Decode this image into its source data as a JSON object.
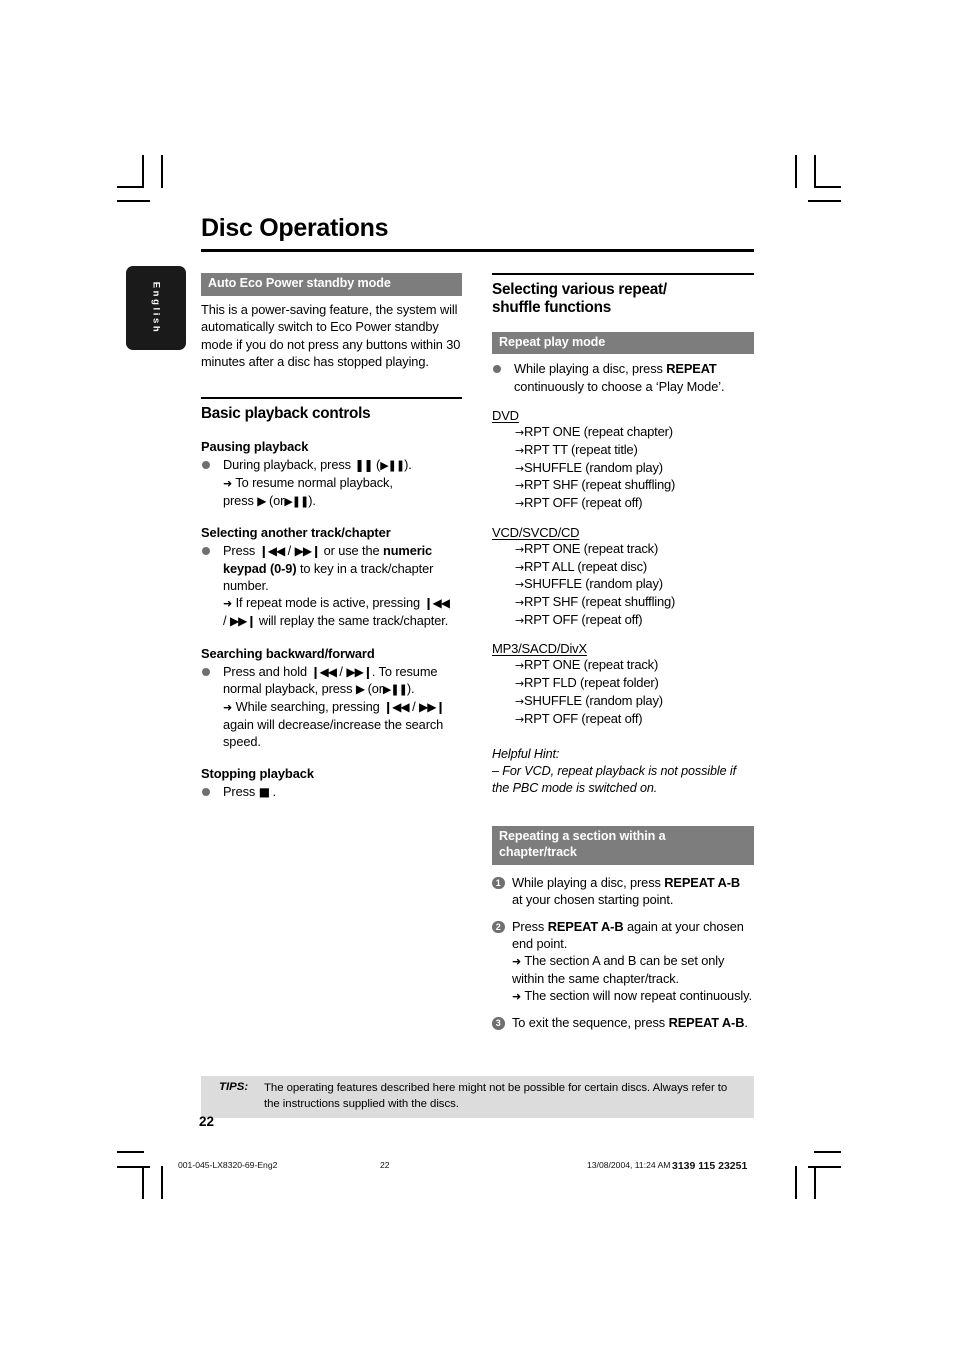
{
  "page": {
    "title": "Disc Operations",
    "language_tab": "English",
    "page_number": "22"
  },
  "left_column": {
    "eco_section": {
      "bar_label": "Auto Eco Power standby mode",
      "body": "This is a power-saving feature, the system will automatically switch to Eco Power standby mode if you do not press any buttons within 30 minutes after a disc has stopped playing."
    },
    "basic_controls": {
      "heading": "Basic playback controls",
      "pausing": {
        "heading": "Pausing playback",
        "line1_pre": "During playback, press",
        "line1_glyph1": "❚❚",
        "line1_mid": "(",
        "line1_glyph2": "▶❚❚",
        "line1_post": ").",
        "arrow_line": "To resume normal playback,",
        "line2_pre": "press",
        "line2_glyph1": "▶",
        "line2_mid": "(or",
        "line2_glyph2": "▶❚❚",
        "line2_post": ")."
      },
      "selecting": {
        "heading": "Selecting another track/chapter",
        "press": "Press",
        "glyph_prev": "❙◀◀",
        "slash": "/",
        "glyph_next": "▶▶❙",
        "or_use": "or use the",
        "numeric_bold": "numeric keypad (0-9)",
        "tail": "to key in a track/chapter number.",
        "arrow_pre": "If repeat mode is active, pressing",
        "arrow_post": "will replay the same track/chapter."
      },
      "searching": {
        "heading": "Searching backward/forward",
        "press_hold": "Press and hold",
        "glyph_prev": "❙◀◀",
        "slash": "/",
        "glyph_next": "▶▶❙",
        "resume": ". To resume normal playback, press",
        "glyph_play": "▶",
        "or_open": "(or",
        "glyph_playpause": "▶❚❚",
        "close": ").",
        "arrow_pre": "While searching, pressing",
        "arrow_post": "again will decrease/increase the search speed."
      },
      "stopping": {
        "heading": "Stopping playback",
        "press": "Press",
        "glyph_stop": "■",
        "period": "."
      }
    }
  },
  "right_column": {
    "repeat_shuffle": {
      "heading_line1": "Selecting various repeat/",
      "heading_line2": "shuffle functions"
    },
    "repeat_play_mode": {
      "bar_label": "Repeat play mode",
      "intro_pre": "While playing a disc, press",
      "intro_bold": "REPEAT",
      "intro_post": "continuously to choose a ‘Play Mode’.",
      "groups": [
        {
          "format": "DVD",
          "modes": [
            "RPT ONE (repeat chapter)",
            "RPT TT (repeat title)",
            "SHUFFLE (random play)",
            "RPT SHF (repeat shuffling)",
            "RPT OFF (repeat off)"
          ]
        },
        {
          "format": "VCD/SVCD/CD",
          "modes": [
            "RPT ONE (repeat track)",
            "RPT ALL (repeat disc)",
            "SHUFFLE (random play)",
            "RPT SHF (repeat shuffling)",
            "RPT OFF (repeat off)"
          ]
        },
        {
          "format": "MP3/SACD/DivX",
          "modes": [
            "RPT ONE (repeat track)",
            "RPT FLD (repeat folder)",
            "SHUFFLE (random play)",
            "RPT OFF (repeat off)"
          ]
        }
      ],
      "hint_title": "Helpful Hint:",
      "hint_body": "–  For VCD, repeat playback is not possible if the PBC mode is switched on."
    },
    "repeat_section": {
      "bar_label_line1": "Repeating a section within a",
      "bar_label_line2": "chapter/track",
      "steps": [
        {
          "num": "1",
          "pre": "While playing a disc, press",
          "bold": "REPEAT A-B",
          "post": "at your chosen starting point.",
          "arrows": []
        },
        {
          "num": "2",
          "pre": "Press",
          "bold": "REPEAT A-B",
          "post": "again at your chosen end point.",
          "arrows": [
            "The section A and B can be set only within the same chapter/track.",
            "The section will now repeat continuously."
          ]
        },
        {
          "num": "3",
          "pre": "To exit the sequence, press",
          "bold": "REPEAT A-B",
          "post": ".",
          "arrows": []
        }
      ]
    }
  },
  "tips": {
    "label": "TIPS:",
    "text": "The operating features described here might not be possible for certain discs.  Always refer to the instructions supplied with the discs."
  },
  "print_footer": {
    "file": "001-045-LX8320-69-Eng2",
    "page": "22",
    "date": "13/08/2004, 11:24 AM",
    "code": "3139 115 23251"
  },
  "colors": {
    "bar_gray": "#7d7d7d",
    "tips_gray": "#dcdcdc",
    "marker_gray": "#6f6f6f",
    "tab_black": "#1a1a1a"
  }
}
